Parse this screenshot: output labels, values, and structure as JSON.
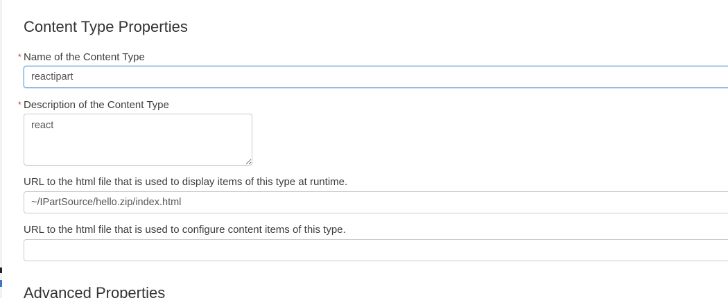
{
  "content_type_properties": {
    "title": "Content Type Properties",
    "name_field": {
      "label": "Name of the Content Type",
      "required_marker": "*",
      "value": "reactipart"
    },
    "description_field": {
      "label": "Description of the Content Type",
      "required_marker": "*",
      "value": "react"
    },
    "runtime_url_field": {
      "label": "URL to the html file that is used to display items of this type at runtime.",
      "value": "~/IPartSource/hello.zip/index.html"
    },
    "config_url_field": {
      "label": "URL to the html file that is used to configure content items of this type.",
      "value": ""
    }
  },
  "advanced_properties": {
    "title": "Advanced Properties"
  },
  "colors": {
    "required": "#c0392b",
    "focus_border": "#6fa8dc"
  }
}
